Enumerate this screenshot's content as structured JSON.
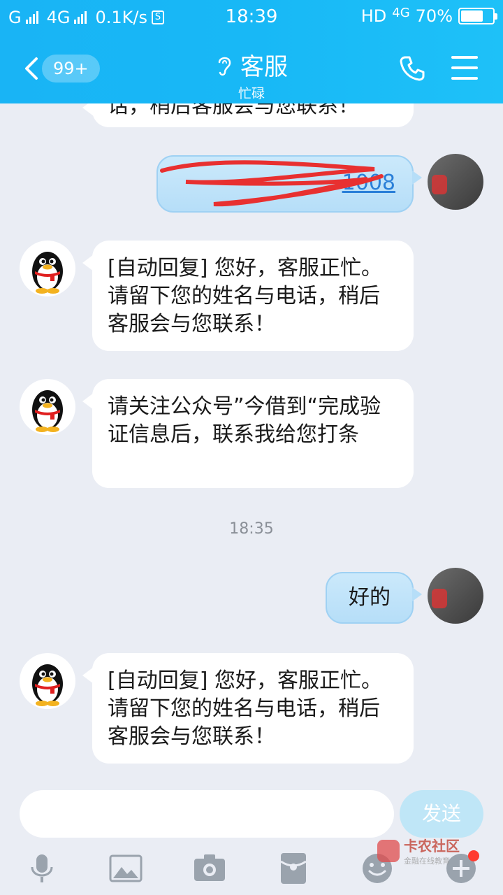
{
  "status_bar": {
    "carrier1": "G",
    "network": "4G",
    "speed": "0.1K/s",
    "time": "18:39",
    "hd": "HD",
    "network2": "4G",
    "battery": "70%",
    "battery_level": 0.7
  },
  "header": {
    "unread_badge": "99+",
    "title": "客服",
    "subtitle": "忙碌",
    "icons": [
      "back-arrow-icon",
      "ear-icon",
      "phone-icon",
      "menu-icon"
    ]
  },
  "messages": [
    {
      "side": "left",
      "text": "话，稍后客服会与您联系！"
    },
    {
      "side": "right",
      "text": "1008"
    },
    {
      "side": "left",
      "text": "[自动回复] 您好，客服正忙。请留下您的姓名与电话，稍后客服会与您联系！"
    },
    {
      "side": "left",
      "text": "请关注公众号”今借到“完成验证信息后，联系我给您打条"
    },
    {
      "side": "time",
      "text": "18:35"
    },
    {
      "side": "right",
      "text": "好的"
    },
    {
      "side": "left",
      "text": "[自动回复] 您好，客服正忙。请留下您的姓名与电话，稍后客服会与您联系！"
    }
  ],
  "input": {
    "placeholder": "",
    "send_label": "发送"
  },
  "toolbar": {
    "icons": [
      "microphone-icon",
      "image-icon",
      "camera-icon",
      "red-packet-icon",
      "emoji-icon",
      "plus-icon"
    ]
  },
  "watermark": {
    "title": "卡农社区",
    "subtitle": "金融在线教育"
  },
  "colors": {
    "header": "#18b8f6",
    "background": "#eaedf4",
    "bubble_right": "#b6def8",
    "link": "#2a7fd8"
  }
}
